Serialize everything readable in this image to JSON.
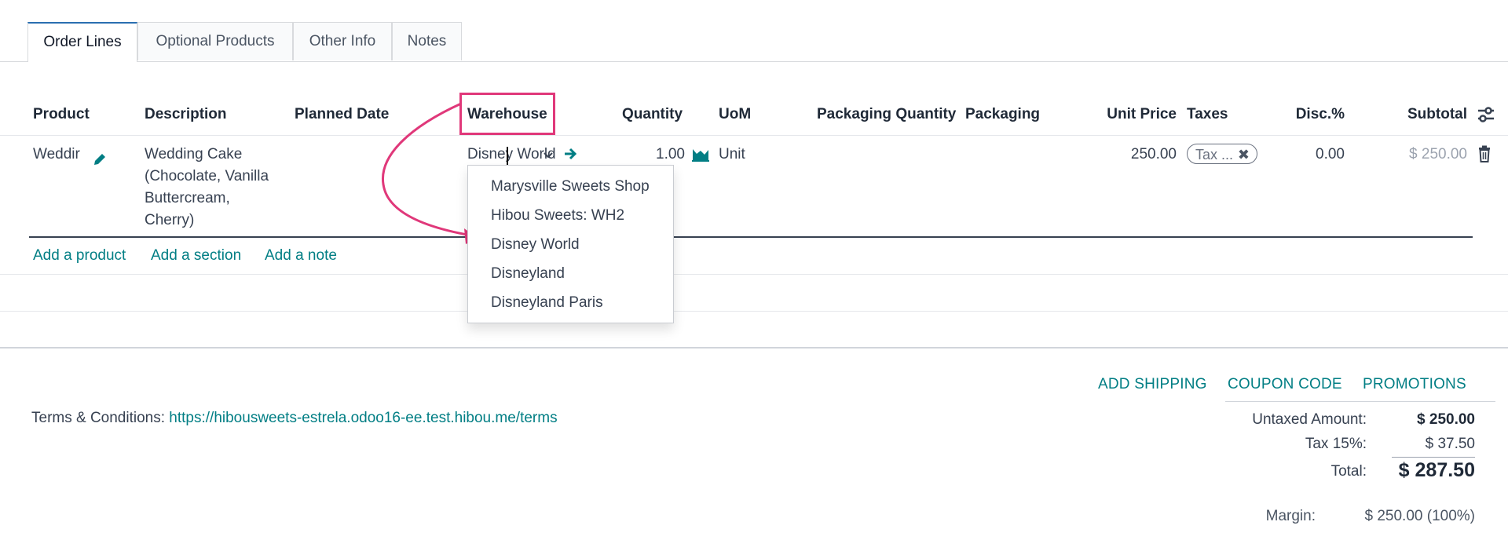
{
  "tabs": [
    "Order Lines",
    "Optional Products",
    "Other Info",
    "Notes"
  ],
  "columns": {
    "product": "Product",
    "description": "Description",
    "planned_date": "Planned Date",
    "warehouse": "Warehouse",
    "quantity": "Quantity",
    "uom": "UoM",
    "packaging_quantity": "Packaging Quantity",
    "packaging": "Packaging",
    "unit_price": "Unit Price",
    "taxes": "Taxes",
    "discount": "Disc.%",
    "subtotal": "Subtotal"
  },
  "line": {
    "product": "Weddir",
    "description": [
      "Wedding Cake",
      "(Chocolate, Vanilla",
      "Buttercream,",
      "Cherry)"
    ],
    "warehouse_value": "Disney World",
    "quantity": "1.00",
    "uom": "Unit",
    "unit_price": "250.00",
    "tax_tag": "Tax ...",
    "discount": "0.00",
    "subtotal": "$ 250.00"
  },
  "warehouse_options": [
    "Marysville Sweets Shop",
    "Hibou Sweets: WH2",
    "Disney World",
    "Disneyland",
    "Disneyland Paris"
  ],
  "add_links": {
    "product": "Add a product",
    "section": "Add a section",
    "note": "Add a note"
  },
  "actions": {
    "shipping": "ADD SHIPPING",
    "coupon": "COUPON CODE",
    "promotions": "PROMOTIONS"
  },
  "terms": {
    "label": "Terms & Conditions:",
    "url": "https://hibousweets-estrela.odoo16-ee.test.hibou.me/terms"
  },
  "totals": {
    "untaxed_label": "Untaxed Amount:",
    "untaxed_value": "$ 250.00",
    "tax_label": "Tax 15%:",
    "tax_value": "$ 37.50",
    "total_label": "Total:",
    "total_value": "$ 287.50",
    "margin_label": "Margin:",
    "margin_value": "$ 250.00 (100%)"
  },
  "colors": {
    "accent": "#017e84",
    "annotation": "#e0387a",
    "active_tab": "#2a6fb0"
  }
}
